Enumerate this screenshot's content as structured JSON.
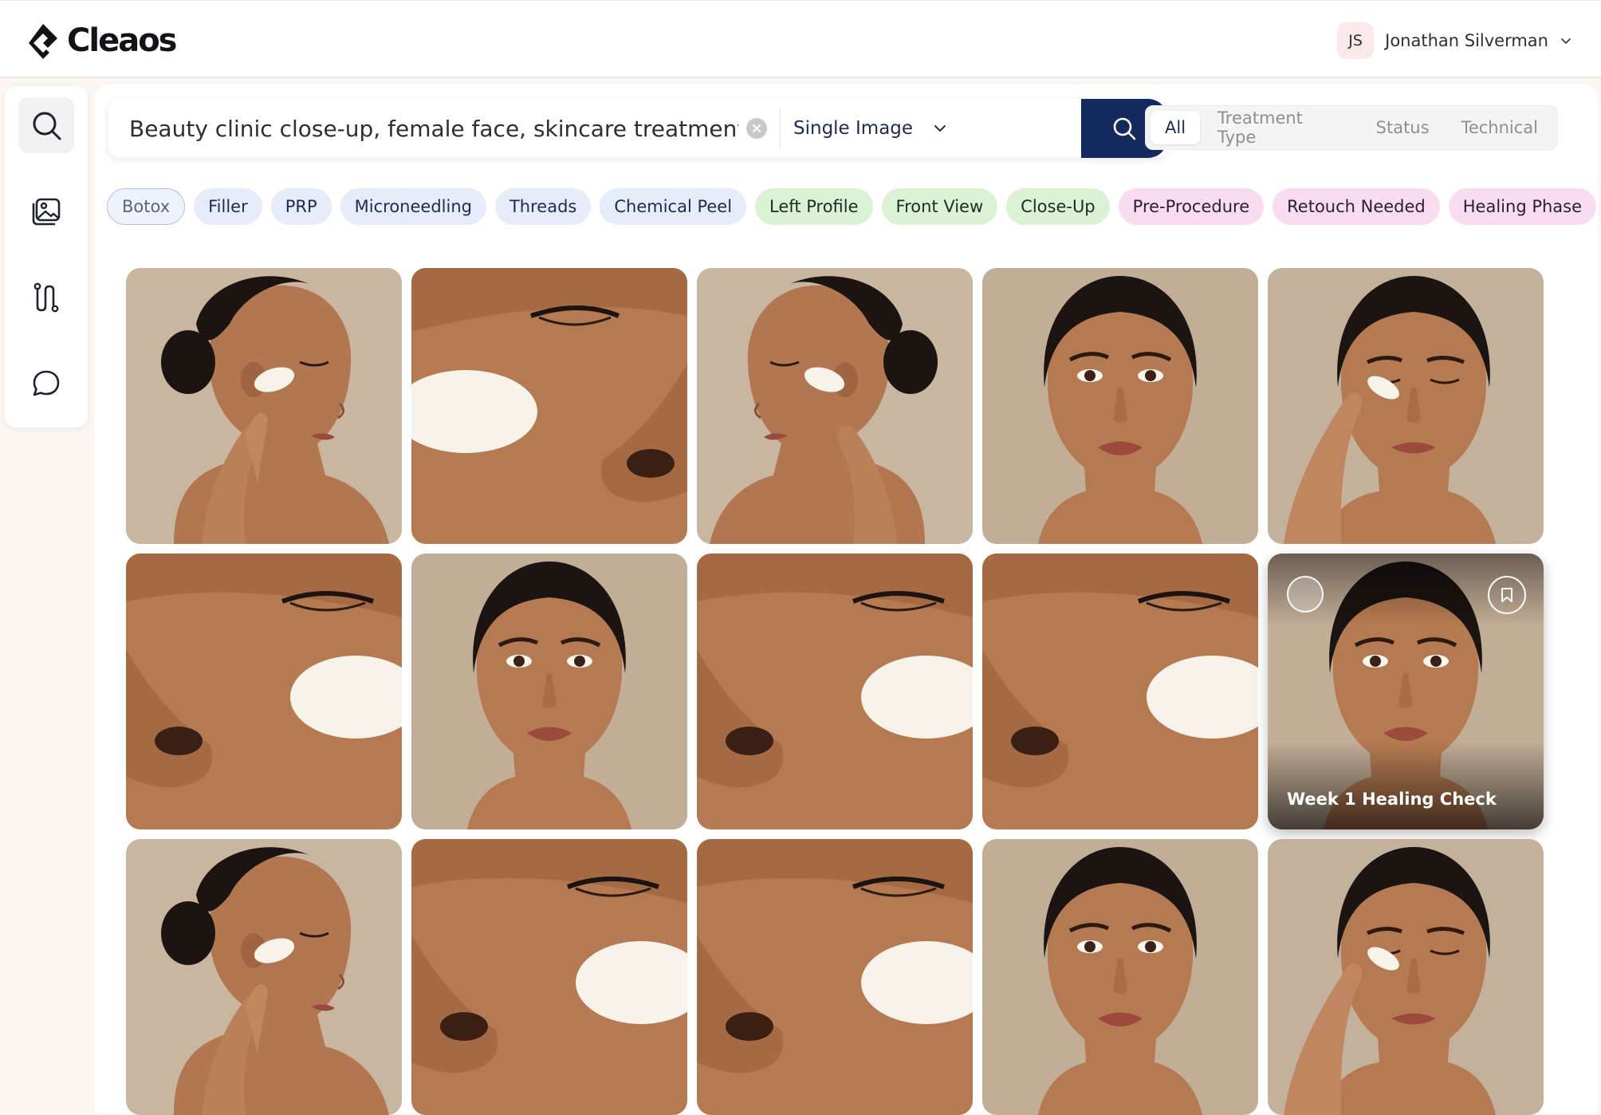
{
  "brand": {
    "name": "Cleaos"
  },
  "user": {
    "initials": "JS",
    "name": "Jonathan Silverman"
  },
  "siderail": {
    "items": [
      {
        "icon": "search-icon",
        "active": true
      },
      {
        "icon": "gallery-icon",
        "active": false
      },
      {
        "icon": "workflow-icon",
        "active": false
      },
      {
        "icon": "chat-icon",
        "active": false
      }
    ]
  },
  "search": {
    "query": "Beauty clinic close-up, female face, skincare treatment",
    "mode": "Single Image"
  },
  "filter_tabs": [
    "All",
    "Treatment Type",
    "Status",
    "Technical"
  ],
  "active_filter_tab": "All",
  "chips": [
    {
      "label": "Botox",
      "color": "outlined"
    },
    {
      "label": "Filler",
      "color": "blue"
    },
    {
      "label": "PRP",
      "color": "blue"
    },
    {
      "label": "Microneedling",
      "color": "blue"
    },
    {
      "label": "Threads",
      "color": "blue"
    },
    {
      "label": "Chemical Peel",
      "color": "blue"
    },
    {
      "label": "Left Profile",
      "color": "green"
    },
    {
      "label": "Front View",
      "color": "green"
    },
    {
      "label": "Close-Up",
      "color": "green"
    },
    {
      "label": "Pre-Procedure",
      "color": "pink"
    },
    {
      "label": "Retouch Needed",
      "color": "pink"
    },
    {
      "label": "Healing Phase",
      "color": "pink"
    }
  ],
  "gallery": {
    "hovered_caption": "Week 1 Healing Check",
    "tiles": [
      "profile-right",
      "closeup-left",
      "profile-left",
      "front",
      "touch-right",
      "closeup-right",
      "front",
      "closeup-right",
      "closeup-right",
      "front-hover",
      "profile-right",
      "closeup-right",
      "closeup-right",
      "front",
      "touch-right"
    ]
  },
  "colors": {
    "brand_navy": "#142a5e",
    "chip_blue": "#e6ecfa",
    "chip_green": "#dcf2d4",
    "chip_pink": "#fadcf0",
    "skin": "#b57a52",
    "background_beige": "#c9b6a0"
  }
}
